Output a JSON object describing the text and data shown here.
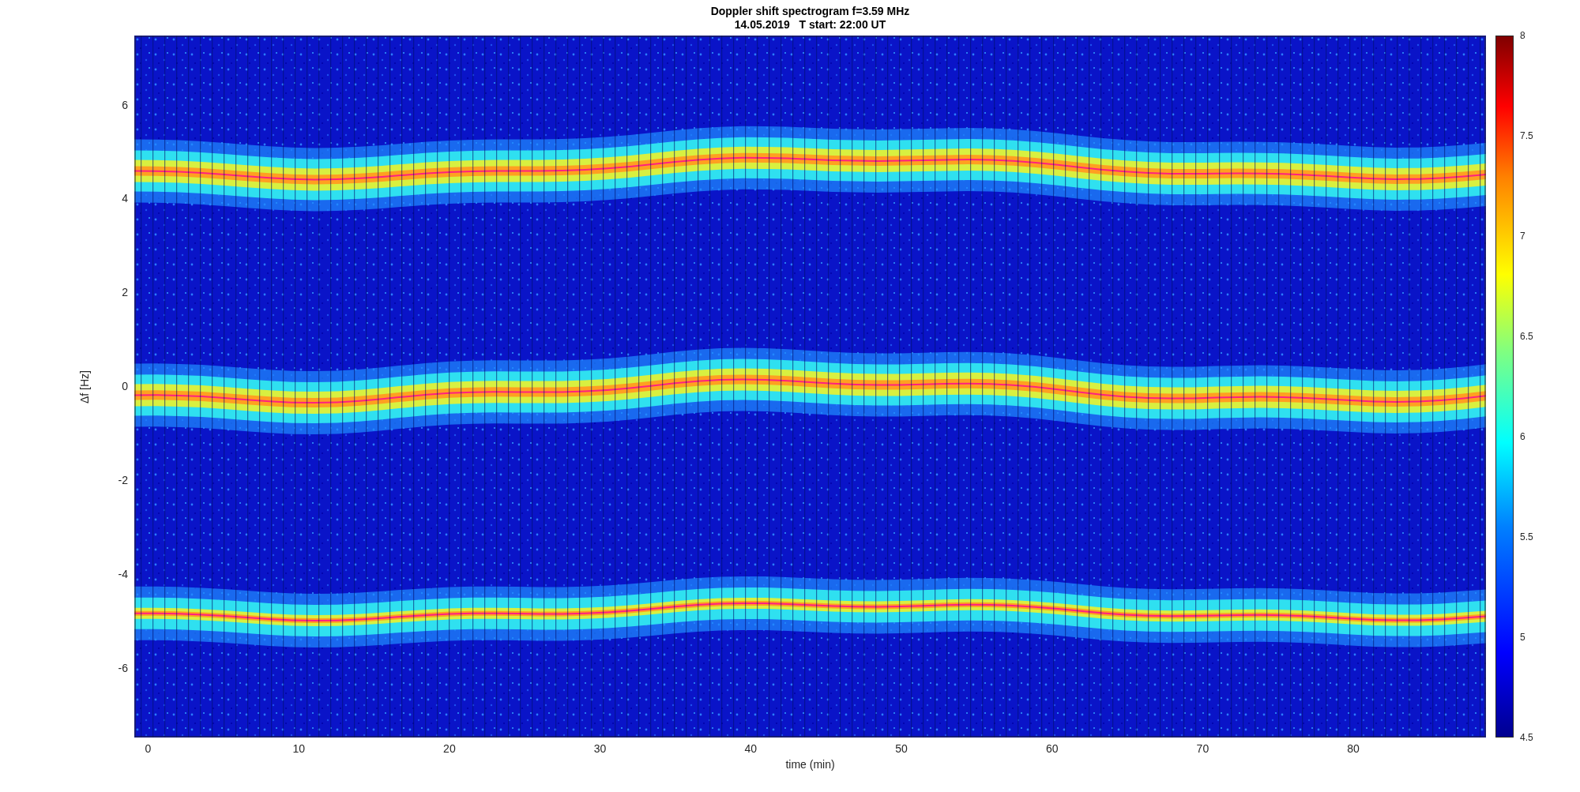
{
  "figure": {
    "title": "Doppler shift spectrogram f=3.59 MHz",
    "subtitle": "14.05.2019   T start: 22:00 UT",
    "y_axis": {
      "label": "Δf [Hz]",
      "ticks": [
        "6",
        "4",
        "2",
        "0",
        "-2",
        "-4",
        "-6"
      ]
    },
    "x_axis": {
      "label": "time (min)",
      "ticks": [
        "0",
        "10",
        "20",
        "30",
        "40",
        "50",
        "60",
        "70",
        "80"
      ]
    },
    "colorbar": {
      "ticks": [
        "8",
        "7.5",
        "7",
        "6.5",
        "6",
        "5.5",
        "5",
        "4.5"
      ]
    }
  }
}
